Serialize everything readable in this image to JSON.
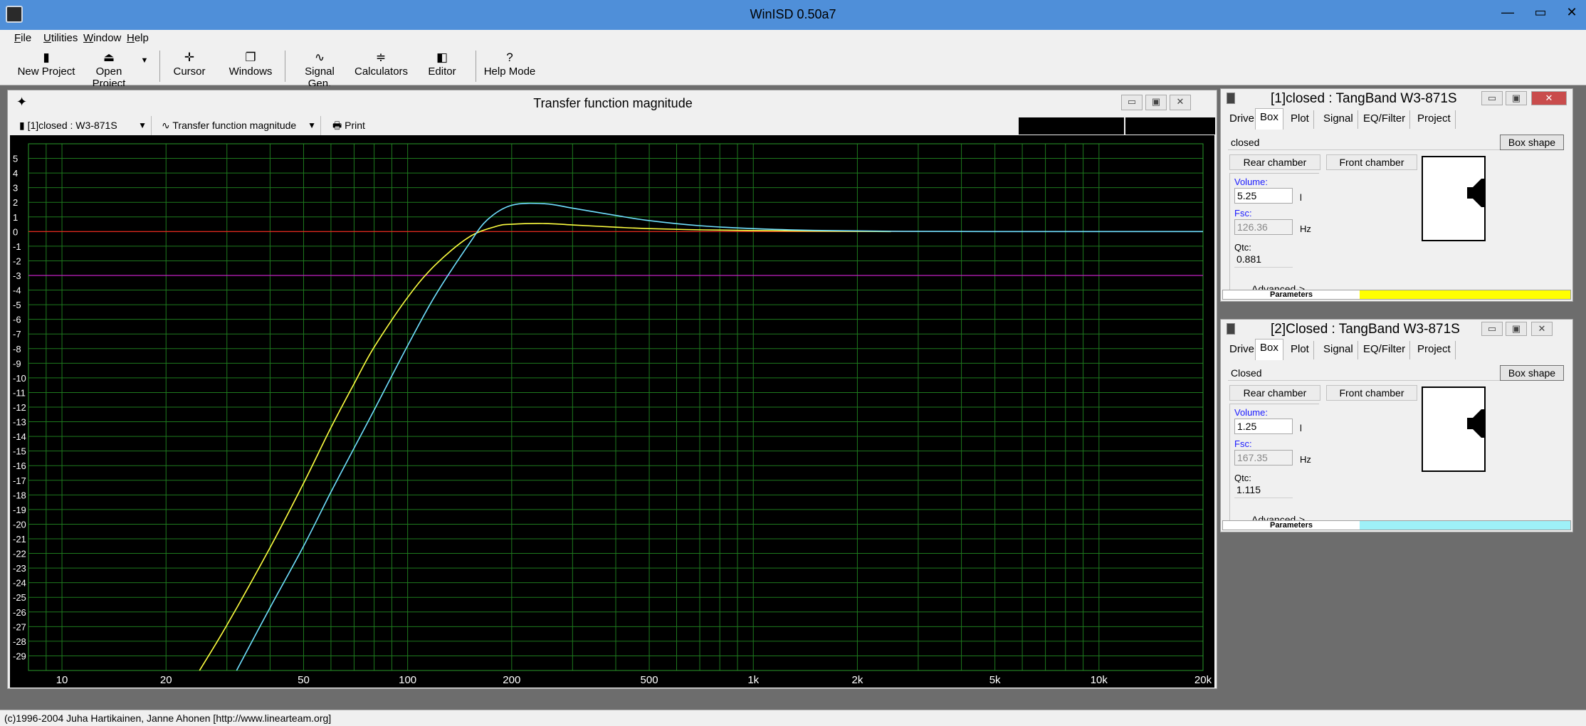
{
  "app": {
    "title": "WinISD 0.50a7",
    "controls": {
      "minimize": "—",
      "maximize": "▭",
      "close": "✕"
    }
  },
  "menu": [
    {
      "label": "File",
      "key": "F",
      "rest": "ile"
    },
    {
      "label": "Utilities",
      "key": "U",
      "rest": "tilities"
    },
    {
      "label": "Window",
      "key": "W",
      "rest": "indow"
    },
    {
      "label": "Help",
      "key": "H",
      "rest": "elp"
    }
  ],
  "toolbar": [
    {
      "label": "New Project",
      "icon": "speaker-icon"
    },
    {
      "label": "Open Project",
      "icon": "open-folder-icon"
    },
    {
      "label": "Cursor",
      "icon": "cursor-icon"
    },
    {
      "label": "Windows",
      "icon": "windows-icon"
    },
    {
      "label": "Signal Gen.",
      "icon": "sine-wave-icon"
    },
    {
      "label": "Calculators",
      "icon": "calculator-icon"
    },
    {
      "label": "Editor",
      "icon": "editor-icon"
    },
    {
      "label": "Help Mode",
      "icon": "help-icon"
    }
  ],
  "graph_window": {
    "title": "Transfer function magnitude",
    "project_combo": "[1]closed : W3-871S",
    "graph_combo": "Transfer function magnitude",
    "print_label": "Print"
  },
  "chart_data": {
    "type": "line",
    "title": "",
    "xlabel": "",
    "ylabel": "",
    "x_scale": "log",
    "xlim": [
      8,
      20000
    ],
    "ylim": [
      -30,
      6
    ],
    "grid": true,
    "x_tick_labels": [
      "10",
      "20",
      "50",
      "100",
      "200",
      "500",
      "1k",
      "2k",
      "5k",
      "10k",
      "20k"
    ],
    "x_tick_values": [
      10,
      20,
      50,
      100,
      200,
      500,
      1000,
      2000,
      5000,
      10000,
      20000
    ],
    "y_tick_labels": [
      "5",
      "4",
      "3",
      "2",
      "1",
      "0",
      "-1",
      "-2",
      "-3",
      "-4",
      "-5",
      "-6",
      "-7",
      "-8",
      "-9",
      "-10",
      "-11",
      "-12",
      "-13",
      "-14",
      "-15",
      "-16",
      "-17",
      "-18",
      "-19",
      "-20",
      "-21",
      "-22",
      "-23",
      "-24",
      "-25",
      "-26",
      "-27",
      "-28",
      "-29"
    ],
    "y_tick_values": [
      5,
      4,
      3,
      2,
      1,
      0,
      -1,
      -2,
      -3,
      -4,
      -5,
      -6,
      -7,
      -8,
      -9,
      -10,
      -11,
      -12,
      -13,
      -14,
      -15,
      -16,
      -17,
      -18,
      -19,
      -20,
      -21,
      -22,
      -23,
      -24,
      -25,
      -26,
      -27,
      -28,
      -29
    ],
    "reference_lines": [
      {
        "y": 0,
        "color": "#ff2020"
      },
      {
        "y": -3,
        "color": "#c020c0"
      }
    ],
    "series": [
      {
        "color": "#ffff40",
        "x": [
          25,
          30,
          40,
          50,
          60,
          70,
          80,
          100,
          120,
          150,
          180,
          200,
          250,
          300,
          400,
          500,
          700,
          1000,
          1500,
          2500
        ],
        "y": [
          -30,
          -26.9,
          -21.6,
          -17.2,
          -13.4,
          -10.4,
          -7.9,
          -4.5,
          -2.3,
          -0.4,
          0.35,
          0.5,
          0.55,
          0.45,
          0.3,
          0.2,
          0.12,
          0.07,
          0.03,
          0
        ]
      },
      {
        "color": "#70e0ff",
        "x": [
          32,
          40,
          50,
          60,
          70,
          80,
          100,
          120,
          150,
          170,
          200,
          250,
          300,
          400,
          500,
          700,
          1000,
          1500,
          2500,
          5000,
          20000
        ],
        "y": [
          -30,
          -25.7,
          -21.5,
          -17.8,
          -14.8,
          -12.2,
          -7.8,
          -4.4,
          -0.9,
          0.8,
          1.8,
          1.9,
          1.6,
          1.1,
          0.75,
          0.4,
          0.2,
          0.08,
          0.02,
          0,
          0
        ]
      }
    ]
  },
  "driver_windows": [
    {
      "title": "[1]closed : TangBand W3-871S",
      "tabs": [
        "Driver",
        "Box",
        "Plot",
        "Signal",
        "EQ/Filter",
        "Project"
      ],
      "active_tab": "Box",
      "box_name": "closed",
      "box_shape_label": "Box shape",
      "rear_chamber_label": "Rear chamber",
      "front_chamber_label": "Front chamber",
      "volume_label": "Volume:",
      "volume_value": "5.25",
      "volume_unit": "l",
      "fsc_label": "Fsc:",
      "fsc_value": "126.36",
      "fsc_unit": "Hz",
      "qtc_label": "Qtc:",
      "qtc_value": "0.881",
      "advanced_label": "Advanced->",
      "params_label": "Parameters",
      "series_color": "#ffff00"
    },
    {
      "title": "[2]Closed : TangBand W3-871S",
      "tabs": [
        "Driver",
        "Box",
        "Plot",
        "Signal",
        "EQ/Filter",
        "Project"
      ],
      "active_tab": "Box",
      "box_name": "Closed",
      "box_shape_label": "Box shape",
      "rear_chamber_label": "Rear chamber",
      "front_chamber_label": "Front chamber",
      "volume_label": "Volume:",
      "volume_value": "1.25",
      "volume_unit": "l",
      "fsc_label": "Fsc:",
      "fsc_value": "167.35",
      "fsc_unit": "Hz",
      "qtc_label": "Qtc:",
      "qtc_value": "1.115",
      "advanced_label": "Advanced->",
      "params_label": "Parameters",
      "series_color": "#9ef0f8"
    }
  ],
  "statusbar": {
    "text": "(c)1996-2004 Juha Hartikainen, Janne Ahonen [http://www.linearteam.org]"
  }
}
